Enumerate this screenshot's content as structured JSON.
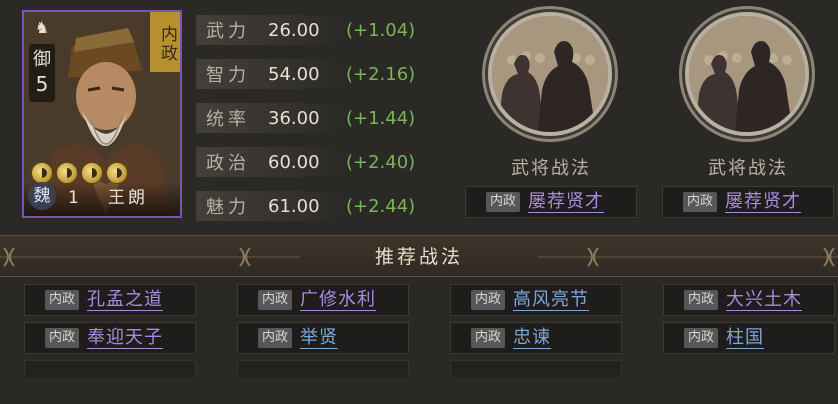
{
  "general": {
    "type_tag": "内政",
    "rank_label": "御",
    "rank_value": "5",
    "faction": "魏",
    "level": "1",
    "name": "王朗",
    "star_count": 4,
    "mount_icon": "horse-icon"
  },
  "stats": [
    {
      "label": "武力",
      "value": "26.00",
      "bonus": "(+1.04)"
    },
    {
      "label": "智力",
      "value": "54.00",
      "bonus": "(+2.16)"
    },
    {
      "label": "统率",
      "value": "36.00",
      "bonus": "(+1.44)"
    },
    {
      "label": "政治",
      "value": "60.00",
      "bonus": "(+2.40)"
    },
    {
      "label": "魅力",
      "value": "61.00",
      "bonus": "(+2.44)"
    }
  ],
  "slots": [
    {
      "title": "武将战法",
      "tag": "内政",
      "skill": "屡荐贤才"
    },
    {
      "title": "武将战法",
      "tag": "内政",
      "skill": "屡荐贤才"
    }
  ],
  "recommend": {
    "title": "推荐战法",
    "items": [
      {
        "tag": "内政",
        "skill": "孔孟之道",
        "color": "purple"
      },
      {
        "tag": "内政",
        "skill": "广修水利",
        "color": "purple"
      },
      {
        "tag": "内政",
        "skill": "高风亮节",
        "color": "blue"
      },
      {
        "tag": "内政",
        "skill": "大兴土木",
        "color": "purple"
      },
      {
        "tag": "内政",
        "skill": "奉迎天子",
        "color": "purple"
      },
      {
        "tag": "内政",
        "skill": "举贤",
        "color": "blue"
      },
      {
        "tag": "内政",
        "skill": "忠谏",
        "color": "blue"
      },
      {
        "tag": "内政",
        "skill": "柱国",
        "color": "blue"
      }
    ]
  },
  "colors": {
    "card_border": "#7a54b7",
    "bonus_green": "#79b558",
    "skill_purple": "#a98bdc",
    "skill_blue": "#7fa7d8",
    "type_gold": "#b7902f"
  }
}
